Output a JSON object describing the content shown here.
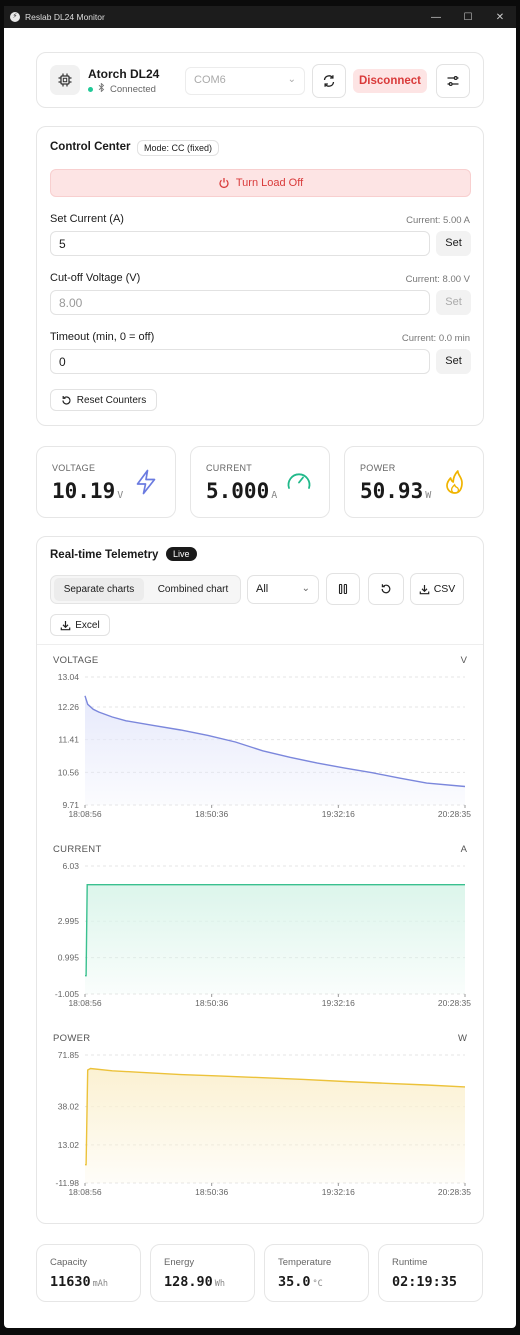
{
  "window": {
    "title": "Reslab DL24 Monitor",
    "minimize": "—",
    "maximize": "☐",
    "close": "✕"
  },
  "device": {
    "name": "Atorch DL24",
    "status": "Connected",
    "port": "COM6",
    "disconnect_label": "Disconnect"
  },
  "control": {
    "title": "Control Center",
    "mode": "Mode: CC (fixed)",
    "load_button": "Turn Load Off",
    "fields": [
      {
        "label": "Set Current (A)",
        "current": "Current: 5.00 A",
        "value": "5",
        "set": "Set"
      },
      {
        "label": "Cut-off Voltage (V)",
        "current": "Current: 8.00 V",
        "value": "8.00",
        "set": "Set"
      },
      {
        "label": "Timeout (min, 0 = off)",
        "current": "Current: 0.0 min",
        "value": "0",
        "set": "Set"
      }
    ],
    "reset_label": "Reset Counters"
  },
  "stats": [
    {
      "label": "VOLTAGE",
      "value": "10.19",
      "unit": "V",
      "icon": "lightning-icon",
      "color": "#6b7be0"
    },
    {
      "label": "CURRENT",
      "value": "5.000",
      "unit": "A",
      "icon": "gauge-icon",
      "color": "#20b98a"
    },
    {
      "label": "POWER",
      "value": "50.93",
      "unit": "W",
      "icon": "flame-icon",
      "color": "#f0b400"
    }
  ],
  "telemetry": {
    "title": "Real-time Telemetry",
    "live": "Live",
    "tabs": [
      "Separate charts",
      "Combined chart"
    ],
    "active_tab": "Separate charts",
    "range": "All",
    "csv_label": "CSV",
    "excel_label": "Excel"
  },
  "chart_data": [
    {
      "type": "area",
      "title": "VOLTAGE",
      "unit": "V",
      "color": "#7b87dc",
      "fill": "#e6e9fb",
      "x_ticks": [
        "18:08:56",
        "18:50:36",
        "19:32:16",
        "20:28:35"
      ],
      "y_ticks": [
        13.04,
        12.26,
        11.41,
        10.56,
        9.71
      ],
      "ylim": [
        9.71,
        13.04
      ],
      "x": [
        0,
        1,
        3,
        5,
        10,
        15,
        25,
        35,
        45,
        55,
        65,
        75,
        85,
        95,
        105,
        115,
        125,
        139
      ],
      "values": [
        12.55,
        12.33,
        12.2,
        12.13,
        12.0,
        11.9,
        11.78,
        11.66,
        11.52,
        11.35,
        11.12,
        10.95,
        10.8,
        10.67,
        10.55,
        10.41,
        10.28,
        10.19
      ]
    },
    {
      "type": "area",
      "title": "CURRENT",
      "unit": "A",
      "color": "#3ac08f",
      "fill": "#dcf5eb",
      "x_ticks": [
        "18:08:56",
        "18:50:36",
        "19:32:16",
        "20:28:35"
      ],
      "y_ticks": [
        6.03,
        2.995,
        0.995,
        -1.005
      ],
      "ylim": [
        -1.005,
        6.03
      ],
      "x": [
        0,
        0.4,
        0.8,
        139
      ],
      "values": [
        0,
        0,
        5.0,
        5.0
      ]
    },
    {
      "type": "area",
      "title": "POWER",
      "unit": "W",
      "color": "#ecc23a",
      "fill": "#fbf1d2",
      "x_ticks": [
        "18:08:56",
        "18:50:36",
        "19:32:16",
        "20:28:35"
      ],
      "y_ticks": [
        71.85,
        38.02,
        13.02,
        -11.98
      ],
      "ylim": [
        -11.98,
        71.85
      ],
      "x": [
        0,
        0.4,
        1,
        2,
        10,
        20,
        35,
        50,
        65,
        80,
        95,
        110,
        125,
        139
      ],
      "values": [
        0,
        0,
        62.0,
        63.0,
        61.5,
        60.5,
        59.0,
        58.0,
        57.0,
        55.9,
        54.5,
        53.3,
        52.2,
        50.93
      ]
    }
  ],
  "summary": [
    {
      "label": "Capacity",
      "value": "11630",
      "unit": "mAh"
    },
    {
      "label": "Energy",
      "value": "128.90",
      "unit": "Wh"
    },
    {
      "label": "Temperature",
      "value": "35.0",
      "unit": "°C"
    },
    {
      "label": "Runtime",
      "value": "02:19:35",
      "unit": ""
    }
  ]
}
